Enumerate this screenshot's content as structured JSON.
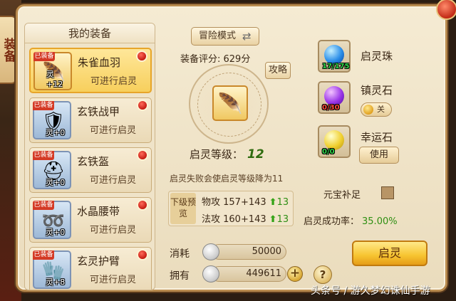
{
  "side_tab": {
    "label": "装备"
  },
  "equipment_list": {
    "title": "我的装备",
    "items": [
      {
        "name": "朱雀血羽",
        "status": "可进行启灵",
        "tag": "已装备",
        "level": "灵+12",
        "icon": "feather-crest-icon",
        "selected": true
      },
      {
        "name": "玄铁战甲",
        "status": "可进行启灵",
        "tag": "已装备",
        "level": "灵+0",
        "icon": "armor-icon",
        "selected": false
      },
      {
        "name": "玄铁盔",
        "status": "可进行启灵",
        "tag": "已装备",
        "level": "灵+0",
        "icon": "helmet-icon",
        "selected": false
      },
      {
        "name": "水晶腰带",
        "status": "可进行启灵",
        "tag": "已装备",
        "level": "灵+0",
        "icon": "belt-icon",
        "selected": false
      },
      {
        "name": "玄灵护臂",
        "status": "可进行启灵",
        "tag": "已装备",
        "level": "灵+8",
        "icon": "bracer-icon",
        "selected": false
      }
    ]
  },
  "center": {
    "mode_button": "冒险模式",
    "score": "装备评分: 629分",
    "guide_button": "攻略",
    "enhance_level_label": "启灵等级：",
    "enhance_level_value": "12",
    "fail_note": "启灵失败会使启灵等级降为11",
    "preview_tag": "下级预览",
    "stats": [
      {
        "text": "物攻 157+143",
        "gain": "13"
      },
      {
        "text": "法攻 160+143",
        "gain": "13"
      }
    ]
  },
  "stones": [
    {
      "name": "启灵珠",
      "count": "17/175",
      "count_color": "#2fd84a",
      "icon": "blue-orb-icon",
      "control": null
    },
    {
      "name": "镇灵石",
      "count": "0/30",
      "count_color": "#ff4a3a",
      "icon": "purple-orb-icon",
      "control": "关"
    },
    {
      "name": "幸运石",
      "count": "0/0",
      "count_color": "#2fd84a",
      "icon": "yellow-orb-icon",
      "control": "使用"
    }
  ],
  "yuanbao": {
    "label": "元宝补足",
    "checked": false
  },
  "success_rate": {
    "label": "启灵成功率：",
    "value": "35.00%"
  },
  "cost": {
    "label": "消耗",
    "value": "50000"
  },
  "owned": {
    "label": "拥有",
    "value": "449611"
  },
  "enhance_button": "启灵",
  "help_button": "?",
  "plus_button": "+",
  "watermark": "头条号 / 游久梦幻诛仙手游",
  "colors": {
    "accent_gold": "#f7c430",
    "success_green": "#2e8f12",
    "panel_bg": "#f5ebd3"
  }
}
